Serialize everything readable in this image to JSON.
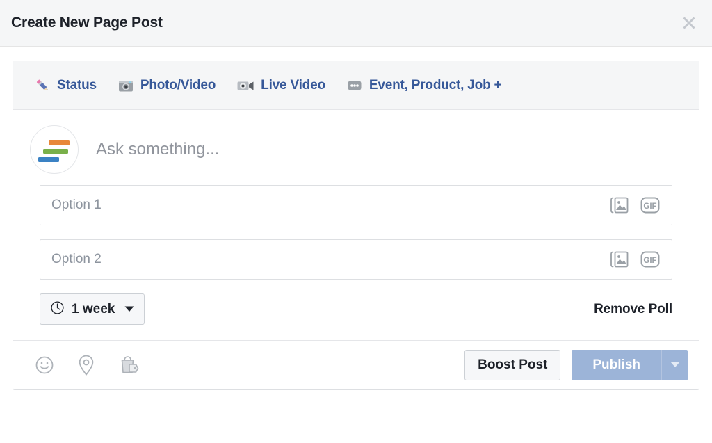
{
  "header": {
    "title": "Create New Page Post",
    "close_icon": "close-icon"
  },
  "tabs": [
    {
      "label": "Status",
      "icon": "pencil-icon"
    },
    {
      "label": "Photo/Video",
      "icon": "camera-icon"
    },
    {
      "label": "Live Video",
      "icon": "video-camera-icon"
    },
    {
      "label": "Event, Product, Job +",
      "icon": "ellipsis-icon"
    }
  ],
  "composer": {
    "avatar_icon": "poll-bars-avatar",
    "question_placeholder": "Ask something...",
    "options": [
      {
        "placeholder": "Option 1",
        "photo_icon": "photo-icon",
        "gif_icon": "gif-icon",
        "gif_label": "GIF"
      },
      {
        "placeholder": "Option 2",
        "photo_icon": "photo-icon",
        "gif_icon": "gif-icon",
        "gif_label": "GIF"
      }
    ],
    "duration": {
      "icon": "clock-icon",
      "value": "1 week",
      "caret": "chevron-down-icon"
    },
    "remove_poll_label": "Remove Poll"
  },
  "footer": {
    "icons": [
      {
        "name": "emoji-icon"
      },
      {
        "name": "location-pin-icon"
      },
      {
        "name": "product-tag-icon"
      }
    ],
    "boost_label": "Boost Post",
    "publish_label": "Publish",
    "publish_caret": "chevron-down-icon"
  },
  "colors": {
    "link_blue": "#365899",
    "publish_blue": "#9cb4d8",
    "header_bg": "#f5f6f7",
    "text_dark": "#1d2129",
    "placeholder_gray": "#90949c",
    "bar_orange": "#e8883a",
    "bar_green": "#79b04a",
    "bar_blue": "#3b82c4"
  }
}
